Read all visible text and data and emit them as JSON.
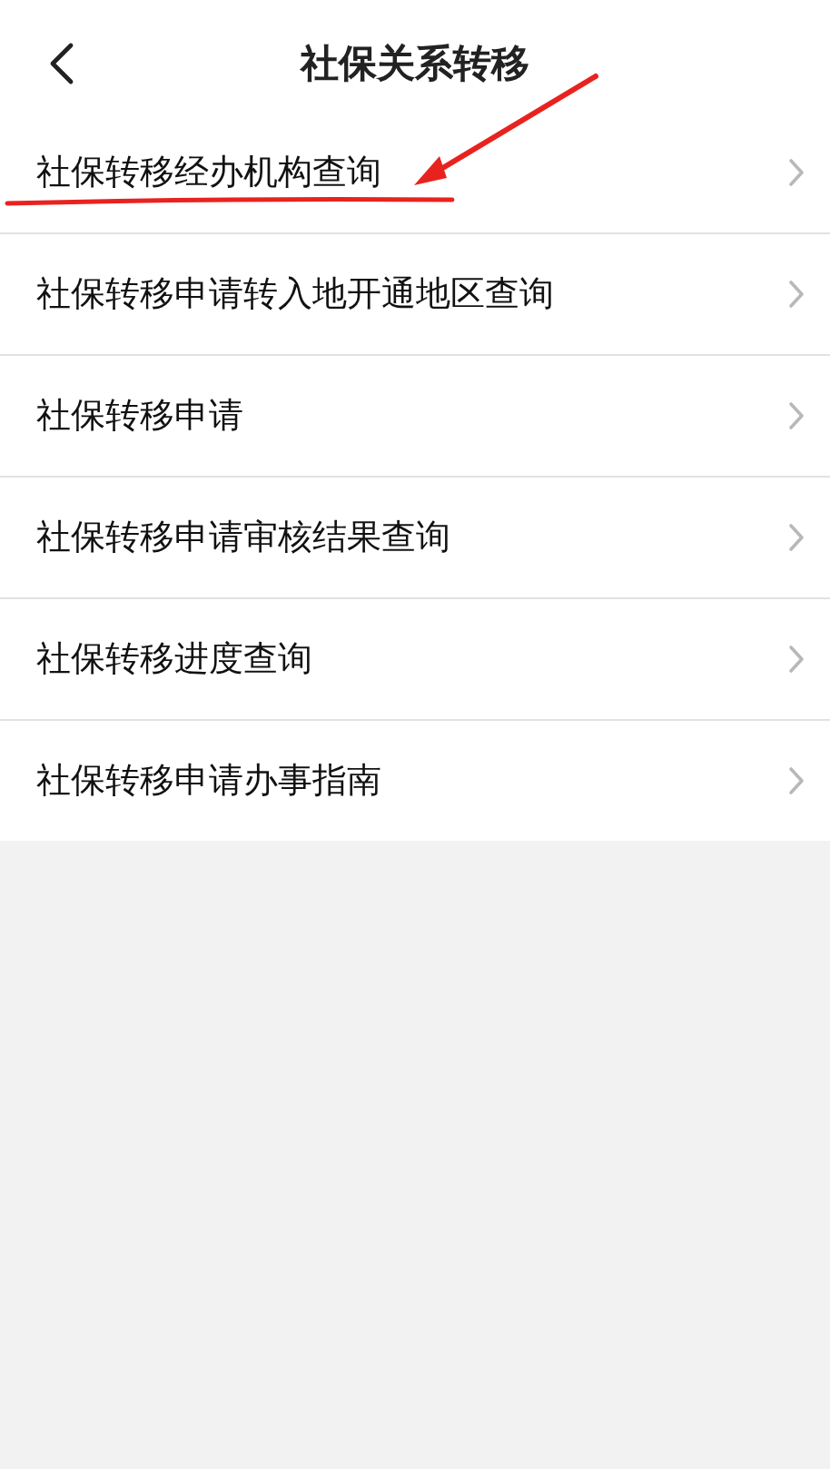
{
  "header": {
    "title": "社保关系转移"
  },
  "menu": [
    {
      "label": "社保转移经办机构查询"
    },
    {
      "label": "社保转移申请转入地开通地区查询"
    },
    {
      "label": "社保转移申请"
    },
    {
      "label": "社保转移申请审核结果查询"
    },
    {
      "label": "社保转移进度查询"
    },
    {
      "label": "社保转移申请办事指南"
    }
  ]
}
